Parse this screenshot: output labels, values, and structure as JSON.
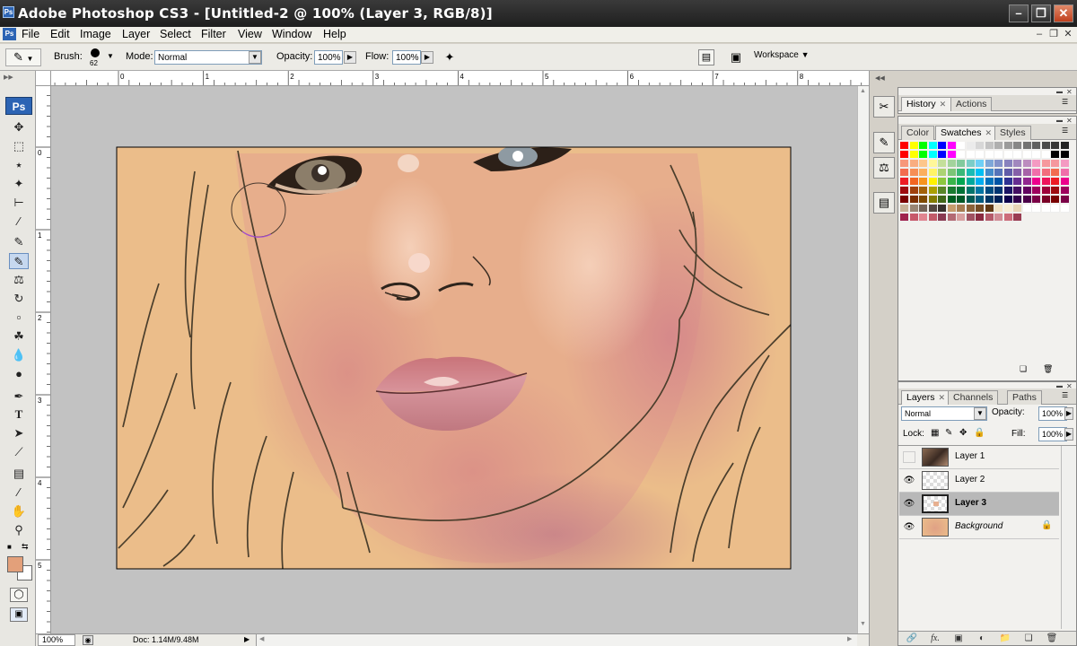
{
  "window": {
    "title": "Adobe Photoshop CS3 - [Untitled-2 @ 100% (Layer 3, RGB/8)]",
    "app_icon": "Ps",
    "controls": [
      "minimize-icon",
      "restore-icon",
      "close-icon"
    ]
  },
  "menu": {
    "items": [
      "File",
      "Edit",
      "Image",
      "Layer",
      "Select",
      "Filter",
      "View",
      "Window",
      "Help"
    ]
  },
  "options": {
    "brush_label": "Brush:",
    "brush_size": "62",
    "mode_label": "Mode:",
    "mode_value": "Normal",
    "opacity_label": "Opacity:",
    "opacity_value": "100%",
    "flow_label": "Flow:",
    "flow_value": "100%",
    "workspace_label": "Workspace"
  },
  "toolbox": {
    "logo": "Ps",
    "tools": [
      "move-tool-icon",
      "marquee-tool-icon",
      "lasso-tool-icon",
      "magic-wand-icon",
      "crop-tool-icon",
      "eyedropper-tool-icon",
      "healing-brush-icon",
      "brush-tool-icon",
      "clone-stamp-icon",
      "history-brush-icon",
      "eraser-tool-icon",
      "paint-bucket-icon",
      "blur-tool-icon",
      "dodge-tool-icon",
      "pen-tool-icon",
      "type-tool-icon",
      "path-selection-icon",
      "line-tool-icon",
      "notes-tool-icon",
      "eyedropper-2-icon",
      "hand-tool-icon",
      "zoom-tool-icon"
    ],
    "foreground_color": "#e3a07a",
    "background_color": "#ffffff"
  },
  "rulers": {
    "top_labels": [
      "0",
      "1",
      "2",
      "3",
      "4",
      "5",
      "6",
      "7",
      "8"
    ],
    "left_labels": [
      "0",
      "1",
      "2",
      "3",
      "4",
      "5"
    ]
  },
  "status": {
    "zoom": "100%",
    "doc": "Doc: 1.14M/9.48M"
  },
  "history_panel": {
    "tabs": [
      "History",
      "Actions"
    ]
  },
  "swatches_panel": {
    "tabs": [
      "Color",
      "Swatches",
      "Styles"
    ]
  },
  "layers_panel": {
    "tabs": [
      "Layers",
      "Channels",
      "Paths"
    ],
    "blend_mode": "Normal",
    "opacity_label": "Opacity:",
    "opacity_value": "100%",
    "lock_label": "Lock:",
    "fill_label": "Fill:",
    "fill_value": "100%",
    "layers": [
      {
        "name": "Layer 1",
        "visible": false,
        "selected": false
      },
      {
        "name": "Layer 2",
        "visible": true,
        "selected": false
      },
      {
        "name": "Layer 3",
        "visible": true,
        "selected": true
      },
      {
        "name": "Background",
        "visible": true,
        "selected": false,
        "locked": true
      }
    ]
  },
  "colors": {
    "canvas_base": "#ebbd8a",
    "skin_shadow": "#d48a80",
    "lip": "#c57a7e"
  }
}
